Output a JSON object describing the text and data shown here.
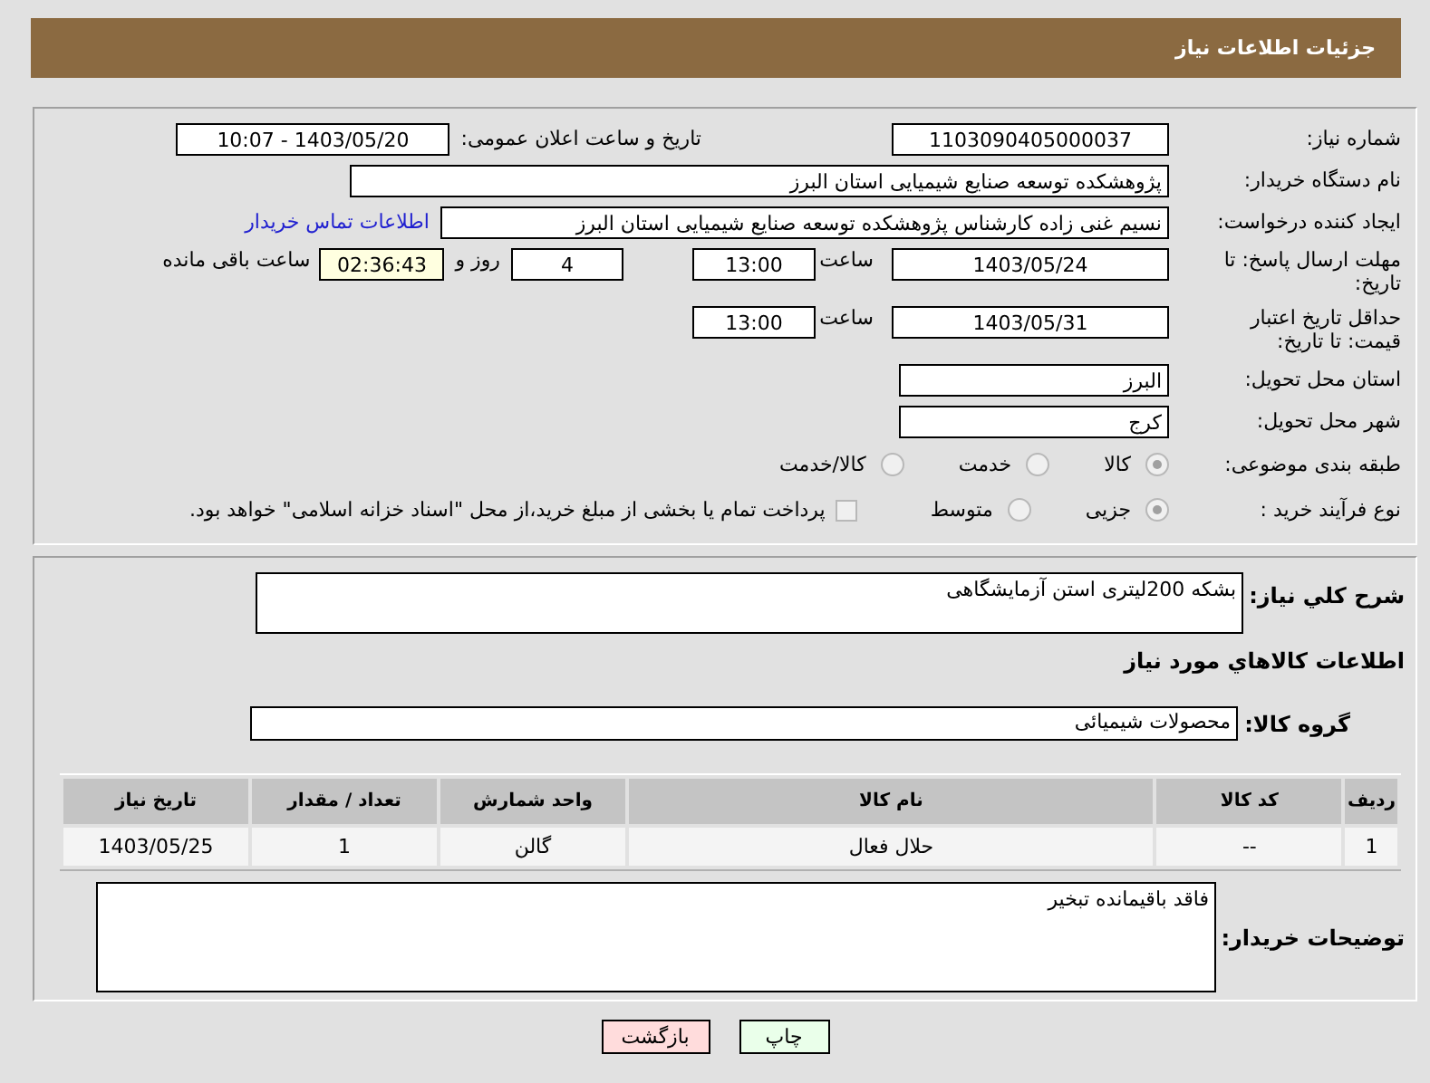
{
  "header": {
    "title": "جزئیات اطلاعات نیاز"
  },
  "need_number": {
    "label": "شماره نیاز:",
    "value": "1103090405000037"
  },
  "announce": {
    "label": "تاریخ و ساعت اعلان عمومی:",
    "value": "1403/05/20 - 10:07"
  },
  "buyer": {
    "label": "نام دستگاه خریدار:",
    "value": "پژوهشکده توسعه صنایع شیمیایی استان البرز"
  },
  "requester": {
    "label": "ایجاد کننده درخواست:",
    "value": "نسیم غنی زاده کارشناس پژوهشکده توسعه صنایع شیمیایی استان البرز",
    "link": "اطلاعات تماس خریدار"
  },
  "response_deadline": {
    "label": "مهلت ارسال پاسخ: تا تاریخ:",
    "date": "1403/05/24",
    "time_label": "ساعت",
    "time": "13:00",
    "days": "4",
    "days_label": "روز و",
    "remaining": "02:36:43",
    "remaining_label": "ساعت باقی مانده"
  },
  "price_validity": {
    "label": "حداقل تاریخ اعتبار قیمت: تا تاریخ:",
    "date": "1403/05/31",
    "time_label": "ساعت",
    "time": "13:00"
  },
  "delivery_province": {
    "label": "استان محل تحویل:",
    "value": "البرز"
  },
  "delivery_city": {
    "label": "شهر محل تحویل:",
    "value": "کرج"
  },
  "category": {
    "label": "طبقه بندی موضوعی:",
    "options": [
      {
        "label": "کالا",
        "selected": true
      },
      {
        "label": "خدمت",
        "selected": false
      },
      {
        "label": "کالا/خدمت",
        "selected": false
      }
    ]
  },
  "purchase_type": {
    "label": "نوع فرآیند خرید :",
    "options": [
      {
        "label": "جزیی",
        "selected": true
      },
      {
        "label": "متوسط",
        "selected": false
      }
    ],
    "treasury": {
      "checked": false,
      "text": "پرداخت تمام یا بخشی از مبلغ خرید،از محل \"اسناد خزانه اسلامی\" خواهد بود."
    }
  },
  "description": {
    "label": "شرح کلي نياز:",
    "value": "بشکه 200لیتری استن آزمایشگاهی"
  },
  "goods_heading": "اطلاعات کالاهاي مورد نياز",
  "goods_group": {
    "label": "گروه کالا:",
    "value": "محصولات شیمیائی"
  },
  "table": {
    "columns": [
      "ردیف",
      "کد کالا",
      "نام کالا",
      "واحد شمارش",
      "تعداد / مقدار",
      "تاریخ نیاز"
    ],
    "rows": [
      [
        "1",
        "--",
        "حلال فعال",
        "گالن",
        "1",
        "1403/05/25"
      ]
    ]
  },
  "buyer_notes": {
    "label": "توضیحات خریدار:",
    "value": "فاقد باقیمانده تبخیر"
  },
  "buttons": [
    {
      "label": "چاپ",
      "kind": "print"
    },
    {
      "label": "بازگشت",
      "kind": "back"
    }
  ]
}
